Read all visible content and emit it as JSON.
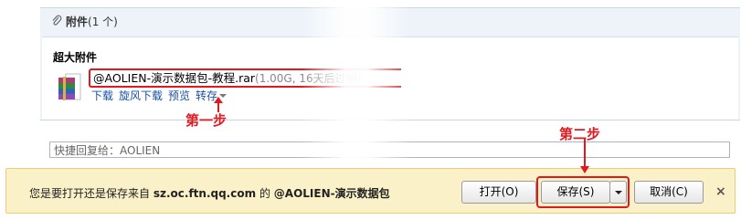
{
  "attachment": {
    "header_label": "附件",
    "header_count": "(1 个)",
    "big_title": "超大附件",
    "file_name": "@AOLIEN-演示数据包-教程.rar",
    "file_meta": "(1.00G, 16天后过期)",
    "actions": {
      "download": "下载",
      "xf_download": "旋风下载",
      "preview": "预览",
      "save": "转存"
    }
  },
  "annotations": {
    "step1": "第一步",
    "step2": "第二步"
  },
  "quick_reply": {
    "placeholder": "快捷回复给：AOLIEN"
  },
  "download_bar": {
    "prefix": "您是要打开还是保存来自",
    "host": "sz.oc.ftn.qq.com",
    "middle": "的",
    "file": "@AOLIEN-演示数据包",
    "open_label": "打开(O)",
    "save_label": "保存(S)",
    "cancel_label": "取消(C)",
    "close_label": "×"
  },
  "colors": {
    "highlight_red": "#e0191f",
    "link_blue": "#1a4fa6",
    "notify_bg": "#fbf1c9"
  }
}
